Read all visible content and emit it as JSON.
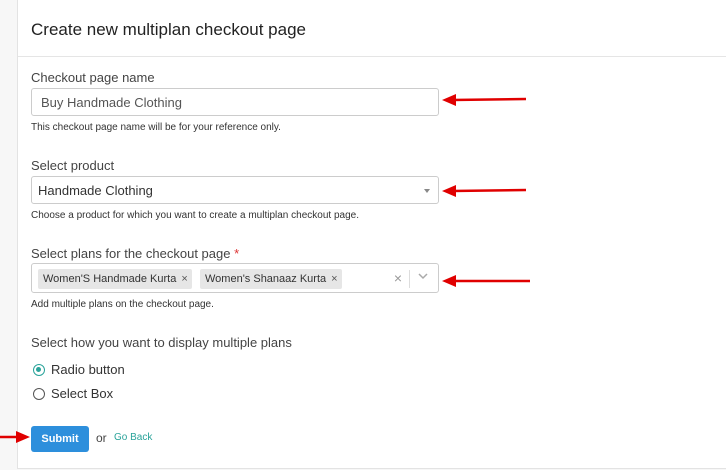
{
  "page": {
    "title": "Create new multiplan checkout page"
  },
  "checkout_name": {
    "label": "Checkout page name",
    "value": "Buy Handmade Clothing",
    "help": "This checkout page name will be for your reference only."
  },
  "product": {
    "label": "Select product",
    "value": "Handmade Clothing",
    "help": "Choose a product for which you want to create a multiplan checkout page."
  },
  "plans": {
    "label": "Select plans for the checkout page",
    "required_mark": "*",
    "chips": [
      {
        "label": "Women'S Handmade Kurta",
        "remove": "×"
      },
      {
        "label": "Women's Shanaaz Kurta",
        "remove": "×"
      }
    ],
    "clear": "×",
    "help": "Add multiple plans on the checkout page."
  },
  "display": {
    "label": "Select how you want to display multiple plans",
    "options": [
      {
        "label": "Radio button",
        "checked": true
      },
      {
        "label": "Select Box",
        "checked": false
      }
    ]
  },
  "actions": {
    "submit": "Submit",
    "or": "or",
    "go_back": "Go Back"
  },
  "colors": {
    "accent": "#2aa39a",
    "primary": "#2d8fdc",
    "annotation": "#e00000"
  }
}
